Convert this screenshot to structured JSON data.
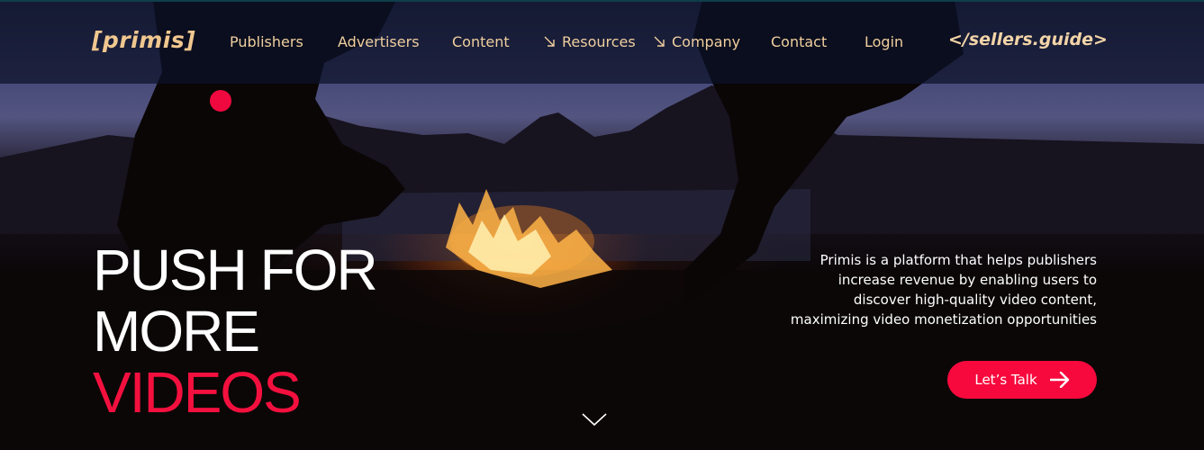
{
  "brand": {
    "logo": "[primis]"
  },
  "nav": {
    "items": [
      {
        "label": "Publishers",
        "arrow": false
      },
      {
        "label": "Advertisers",
        "arrow": false
      },
      {
        "label": "Content",
        "arrow": false
      },
      {
        "label": "Resources",
        "arrow": true
      },
      {
        "label": "Company",
        "arrow": true
      },
      {
        "label": "Contact",
        "arrow": false
      },
      {
        "label": "Login",
        "arrow": false
      }
    ],
    "sellers_guide": "</sellers.guide>"
  },
  "hero": {
    "headline_lines": [
      "PUSH FOR",
      "MORE",
      "VIDEOS"
    ],
    "description": "Primis is a platform that helps publishers increase revenue by enabling users to discover high-quality video content, maximizing video monetization opportunities",
    "description_lines": [
      "Primis is a platform that helps publishers",
      "increase revenue by enabling users to",
      "discover high-quality video content,",
      "maximizing video monetization opportunities"
    ],
    "cta_label": "Let’s Talk"
  },
  "icons": {
    "nav_arrow": "arrow-down-right-icon",
    "cta_arrow": "arrow-right-icon",
    "scroll": "chevron-down-icon"
  },
  "colors": {
    "accent": "#f4103e",
    "nav_text": "#f0cf9f",
    "logo": "#f0c78f"
  }
}
